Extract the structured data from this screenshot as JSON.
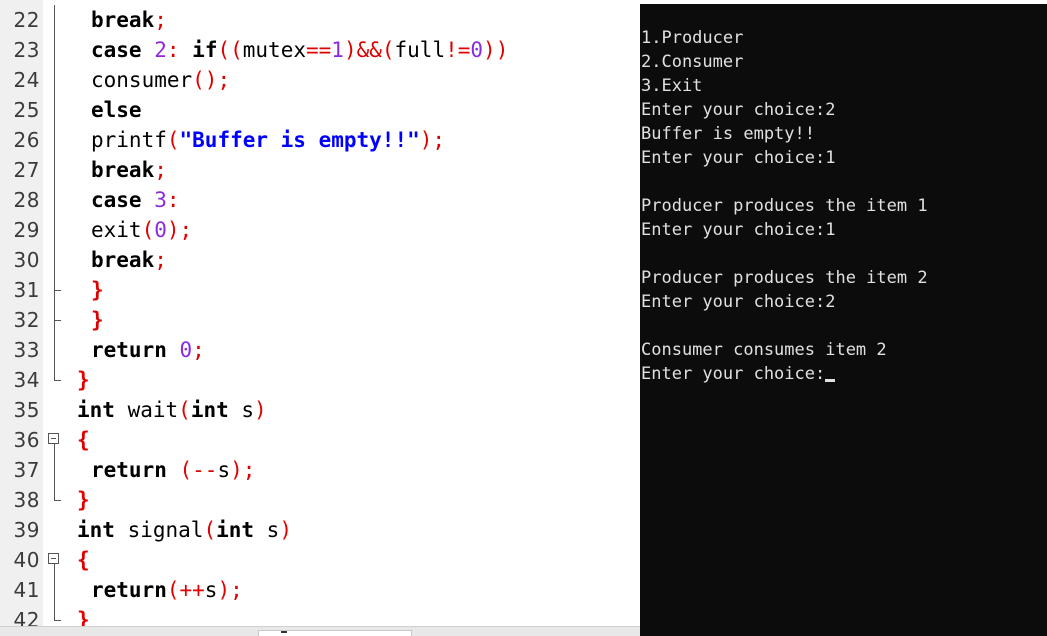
{
  "editor": {
    "lines": [
      {
        "num": "22",
        "fold": "line",
        "indent": 1,
        "tokens": [
          [
            "kw",
            "break"
          ],
          [
            "op",
            ";"
          ]
        ]
      },
      {
        "num": "23",
        "fold": "line",
        "indent": 1,
        "tokens": [
          [
            "kw",
            "case "
          ],
          [
            "num",
            "2"
          ],
          [
            "op",
            ": "
          ],
          [
            "kw",
            "if"
          ],
          [
            "op",
            "(("
          ],
          [
            "id",
            "mutex"
          ],
          [
            "op",
            "=="
          ],
          [
            "num",
            "1"
          ],
          [
            "op",
            ")&&("
          ],
          [
            "id",
            "full"
          ],
          [
            "op",
            "!="
          ],
          [
            "num",
            "0"
          ],
          [
            "op",
            "))"
          ]
        ]
      },
      {
        "num": "24",
        "fold": "line",
        "indent": 1,
        "tokens": [
          [
            "id",
            "consumer"
          ],
          [
            "op",
            "();"
          ]
        ]
      },
      {
        "num": "25",
        "fold": "line",
        "indent": 1,
        "tokens": [
          [
            "kw",
            "else"
          ]
        ]
      },
      {
        "num": "26",
        "fold": "line",
        "indent": 1,
        "tokens": [
          [
            "id",
            "printf"
          ],
          [
            "op",
            "("
          ],
          [
            "str",
            "\"Buffer is empty!!\""
          ],
          [
            "op",
            ");"
          ]
        ]
      },
      {
        "num": "27",
        "fold": "line",
        "indent": 1,
        "tokens": [
          [
            "kw",
            "break"
          ],
          [
            "op",
            ";"
          ]
        ]
      },
      {
        "num": "28",
        "fold": "line",
        "indent": 1,
        "tokens": [
          [
            "kw",
            "case "
          ],
          [
            "num",
            "3"
          ],
          [
            "op",
            ":"
          ]
        ]
      },
      {
        "num": "29",
        "fold": "line",
        "indent": 1,
        "tokens": [
          [
            "id",
            "exit"
          ],
          [
            "op",
            "("
          ],
          [
            "num",
            "0"
          ],
          [
            "op",
            ");"
          ]
        ]
      },
      {
        "num": "30",
        "fold": "line",
        "indent": 1,
        "tokens": [
          [
            "kw",
            "break"
          ],
          [
            "op",
            ";"
          ]
        ]
      },
      {
        "num": "31",
        "fold": "tick",
        "indent": 1,
        "tokens": [
          [
            "br",
            "}"
          ]
        ]
      },
      {
        "num": "32",
        "fold": "tick",
        "indent": 1,
        "tokens": [
          [
            "br",
            "}"
          ]
        ]
      },
      {
        "num": "33",
        "fold": "line",
        "indent": 1,
        "tokens": [
          [
            "kw",
            "return "
          ],
          [
            "num",
            "0"
          ],
          [
            "op",
            ";"
          ]
        ]
      },
      {
        "num": "34",
        "fold": "end",
        "indent": 0,
        "tokens": [
          [
            "br",
            "}"
          ]
        ]
      },
      {
        "num": "35",
        "fold": "none",
        "indent": 0,
        "tokens": [
          [
            "kw",
            "int "
          ],
          [
            "id",
            "wait"
          ],
          [
            "op",
            "("
          ],
          [
            "kw",
            "int "
          ],
          [
            "id",
            "s"
          ],
          [
            "op",
            ")"
          ]
        ]
      },
      {
        "num": "36",
        "fold": "box",
        "indent": 0,
        "tokens": [
          [
            "br",
            "{"
          ]
        ]
      },
      {
        "num": "37",
        "fold": "line",
        "indent": 1,
        "tokens": [
          [
            "kw",
            "return "
          ],
          [
            "op",
            "(--"
          ],
          [
            "id",
            "s"
          ],
          [
            "op",
            ");"
          ]
        ]
      },
      {
        "num": "38",
        "fold": "end",
        "indent": 0,
        "tokens": [
          [
            "br",
            "}"
          ]
        ]
      },
      {
        "num": "39",
        "fold": "none",
        "indent": 0,
        "tokens": [
          [
            "kw",
            "int "
          ],
          [
            "id",
            "signal"
          ],
          [
            "op",
            "("
          ],
          [
            "kw",
            "int "
          ],
          [
            "id",
            "s"
          ],
          [
            "op",
            ")"
          ]
        ]
      },
      {
        "num": "40",
        "fold": "box",
        "indent": 0,
        "tokens": [
          [
            "br",
            "{"
          ]
        ]
      },
      {
        "num": "41",
        "fold": "line",
        "indent": 1,
        "tokens": [
          [
            "kw",
            "return"
          ],
          [
            "op",
            "(++"
          ],
          [
            "id",
            "s"
          ],
          [
            "op",
            ");"
          ]
        ]
      },
      {
        "num": "42",
        "fold": "end",
        "indent": 0,
        "tokens": [
          [
            "br",
            "}"
          ]
        ]
      }
    ]
  },
  "console": {
    "lines": [
      "1.Producer",
      "2.Consumer",
      "3.Exit",
      "Enter your choice:2",
      "Buffer is empty!!",
      "Enter your choice:1",
      "",
      "Producer produces the item 1",
      "Enter your choice:1",
      "",
      "Producer produces the item 2",
      "Enter your choice:2",
      "",
      "Consumer consumes item 2",
      "Enter your choice:"
    ]
  },
  "colors": {
    "keyword": "#000000",
    "operator": "#e00000",
    "number": "#8a2be2",
    "string": "#0000ff",
    "console_bg": "#0c0c0c",
    "console_fg": "#e0e0e0"
  }
}
